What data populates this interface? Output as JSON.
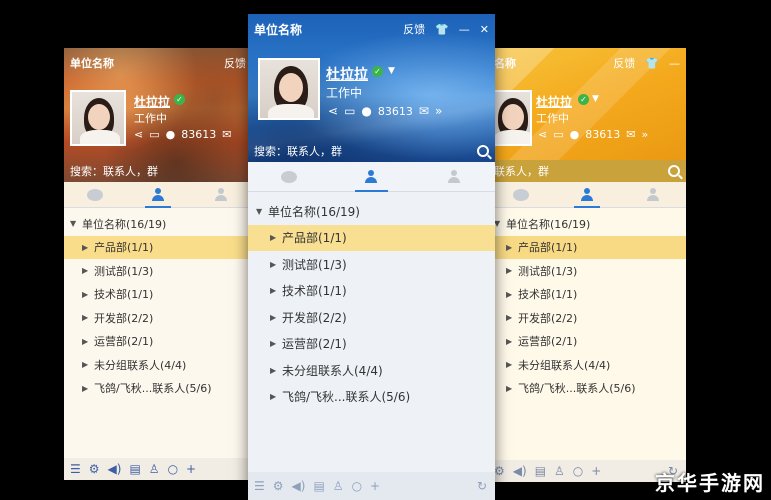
{
  "watermark": "京华手游网",
  "left": {
    "title": "单位名称",
    "feedback": "反馈",
    "user_name": "杜拉拉",
    "status": "工作中",
    "count": "83613",
    "search_placeholder": "搜索：联系人，群",
    "root": "单位名称(16/19)",
    "items": [
      "产品部(1/1)",
      "测试部(1/3)",
      "技术部(1/1)",
      "开发部(2/2)",
      "运营部(2/1)",
      "未分组联系人(4/4)",
      "飞鸽/飞秋...联系人(5/6)"
    ]
  },
  "center": {
    "title": "单位名称",
    "feedback": "反馈",
    "user_name": "杜拉拉",
    "status": "工作中",
    "count": "83613",
    "search_placeholder": "搜索：联系人，群",
    "root": "单位名称(16/19)",
    "items": [
      "产品部(1/1)",
      "测试部(1/3)",
      "技术部(1/1)",
      "开发部(2/2)",
      "运营部(2/1)",
      "未分组联系人(4/4)",
      "飞鸽/飞秋...联系人(5/6)"
    ]
  },
  "right": {
    "title": "名称",
    "feedback": "反馈",
    "user_name": "杜拉拉",
    "status": "工作中",
    "count": "83613",
    "search_placeholder": "联系人，群",
    "root": "单位名称(16/19)",
    "items": [
      "产品部(1/1)",
      "测试部(1/3)",
      "技术部(1/1)",
      "开发部(2/2)",
      "运营部(2/1)",
      "未分组联系人(4/4)",
      "飞鸽/飞秋...联系人(5/6)"
    ]
  },
  "icons": {
    "share": "share-icon",
    "chat": "chat-icon",
    "group": "group-icon",
    "mail": "mail-icon",
    "menu": "menu-icon",
    "settings": "gear-icon",
    "sound": "sound-icon",
    "folder": "folder-icon",
    "contacts": "contacts-icon",
    "search": "search-icon",
    "add": "add-icon",
    "refresh": "refresh-icon"
  },
  "colors": {
    "accent": "#2b7ad6",
    "selection": "#f8df92",
    "online": "#3bb54a"
  }
}
